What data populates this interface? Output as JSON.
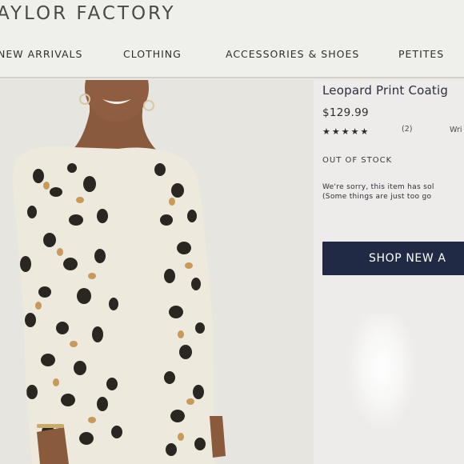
{
  "brand": {
    "logo_text": "AYLOR FACTORY"
  },
  "nav": {
    "items": [
      {
        "label": "NEW ARRIVALS"
      },
      {
        "label": "CLOTHING"
      },
      {
        "label": "ACCESSORIES & SHOES"
      },
      {
        "label": "PETITES"
      }
    ]
  },
  "product": {
    "title": "Leopard Print Coatig",
    "price": "$129.99",
    "rating": {
      "stars": "★★★★★",
      "value": 5,
      "max": 5,
      "count_label": "(2)"
    },
    "write_review_label": "Wri",
    "stock_status": "OUT OF STOCK",
    "sorry_line1": "We're sorry, this item has sol",
    "sorry_line2": "(Some things are just too go",
    "shop_button_label": "SHOP NEW A"
  },
  "colors": {
    "navy_button": "#202a45",
    "coat_base": "#ede9dc",
    "spot_dark": "#2a2622",
    "spot_tan": "#c79a5a",
    "top_mustard": "#d2a36a"
  },
  "icons": {
    "star": "star-icon"
  }
}
